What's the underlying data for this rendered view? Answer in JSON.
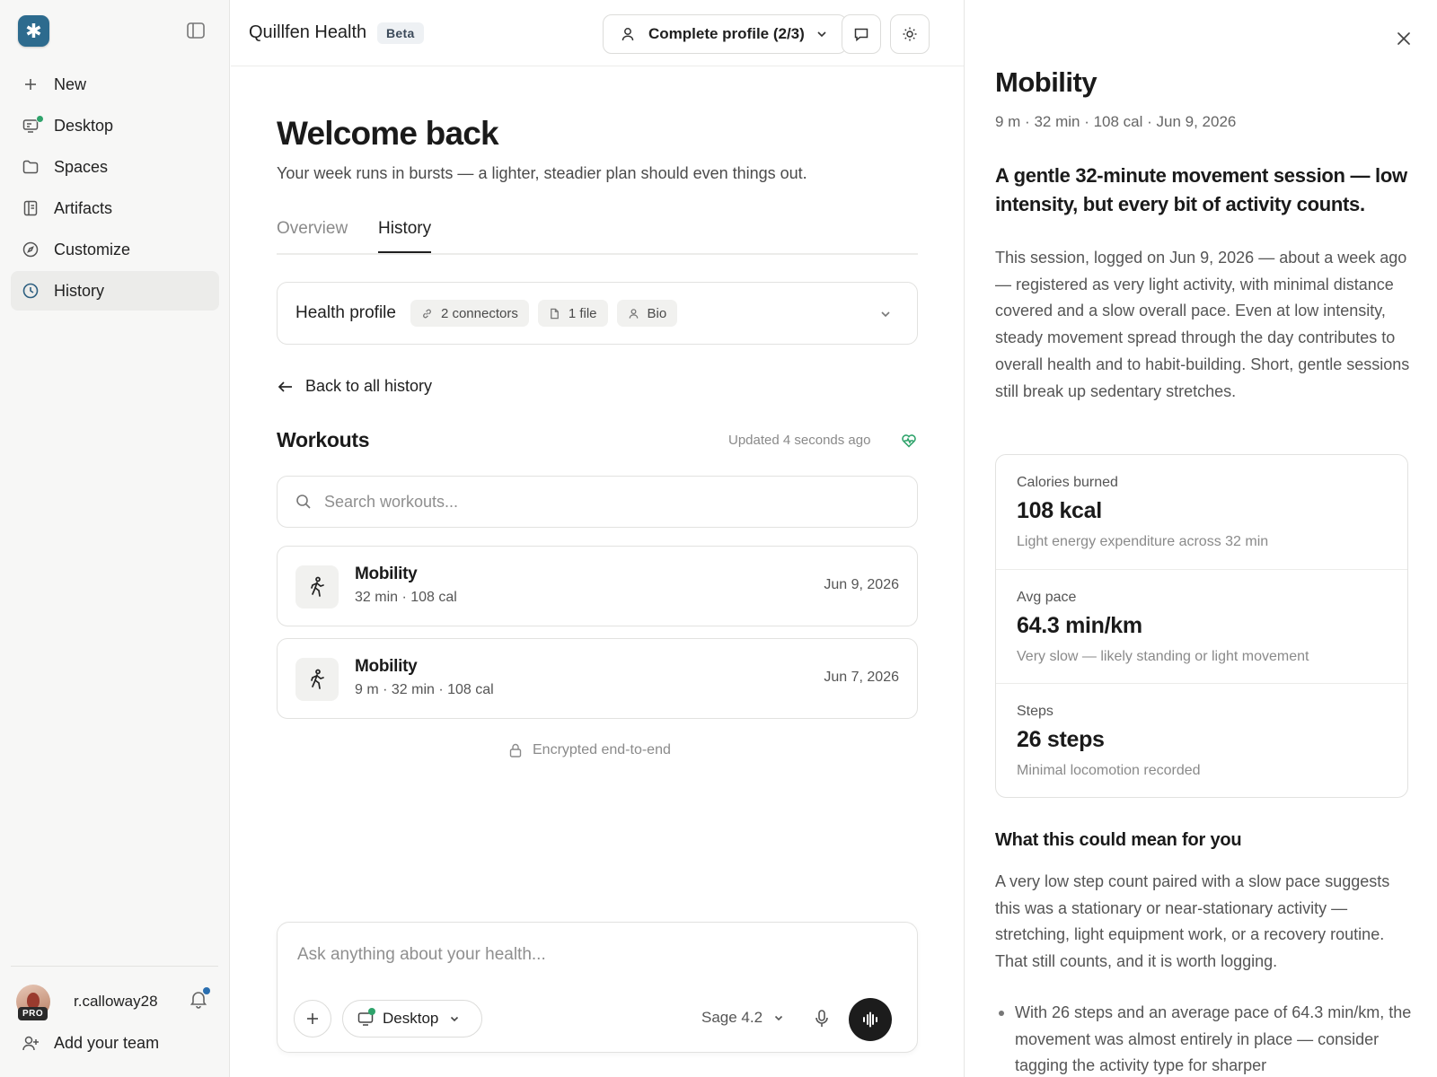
{
  "sidebar": {
    "nav": [
      {
        "label": "New",
        "icon": "plus-icon"
      },
      {
        "label": "Desktop",
        "icon": "desktop-icon"
      },
      {
        "label": "Spaces",
        "icon": "folder-icon"
      },
      {
        "label": "Artifacts",
        "icon": "artifacts-icon"
      },
      {
        "label": "Customize",
        "icon": "compass-icon"
      },
      {
        "label": "History",
        "icon": "clock-icon"
      }
    ],
    "user": {
      "name": "r.calloway28",
      "badge": "PRO"
    },
    "add_team": "Add your team"
  },
  "header": {
    "title": "Quillfen Health",
    "badge": "Beta",
    "profile_button": "Complete profile (2/3)"
  },
  "main": {
    "welcome": "Welcome back",
    "subtitle": "Your week runs in bursts — a lighter, steadier plan should even things out.",
    "tabs": [
      {
        "label": "Overview"
      },
      {
        "label": "History"
      }
    ],
    "health_profile": {
      "title": "Health profile",
      "chips": [
        "2 connectors",
        "1 file",
        "Bio"
      ]
    },
    "back_link": "Back to all history",
    "workouts_title": "Workouts",
    "updated": "Updated 4 seconds ago",
    "search_placeholder": "Search workouts...",
    "workouts": [
      {
        "name": "Mobility",
        "meta": "32 min · 108 cal",
        "date": "Jun 9, 2026"
      },
      {
        "name": "Mobility",
        "meta": "9 m · 32 min · 108 cal",
        "date": "Jun 7, 2026"
      }
    ],
    "encrypted": "Encrypted end-to-end"
  },
  "composer": {
    "placeholder": "Ask anything about your health...",
    "desktop_label": "Desktop",
    "model": "Sage 4.2"
  },
  "panel": {
    "title": "Mobility",
    "meta": "9 m · 32 min · 108 cal · Jun 9, 2026",
    "headline": "A gentle 32-minute movement session — low intensity, but every bit of activity counts.",
    "body": "This session, logged on Jun 9, 2026 — about a week ago — registered as very light activity, with minimal distance covered and a slow overall pace. Even at low intensity, steady movement spread through the day contributes to overall health and to habit-building. Short, gentle sessions still break up sedentary stretches.",
    "stats": [
      {
        "label": "Calories burned",
        "value": "108 kcal",
        "desc": "Light energy expenditure across 32 min"
      },
      {
        "label": "Avg pace",
        "value": "64.3 min/km",
        "desc": "Very slow — likely standing or light movement"
      },
      {
        "label": "Steps",
        "value": "26 steps",
        "desc": "Minimal locomotion recorded"
      }
    ],
    "section_title": "What this could mean for you",
    "section_body": "A very low step count paired with a slow pace suggests this was a stationary or near-stationary activity — stretching, light equipment work, or a recovery routine. That still counts, and it is worth logging.",
    "bullets": [
      "With 26 steps and an average pace of 64.3 min/km, the movement was almost entirely in place — consider tagging the activity type for sharper"
    ]
  },
  "colors": {
    "accent": "#2d6b8e",
    "status_green": "#2fa36b",
    "notify_blue": "#2a6fb0"
  }
}
